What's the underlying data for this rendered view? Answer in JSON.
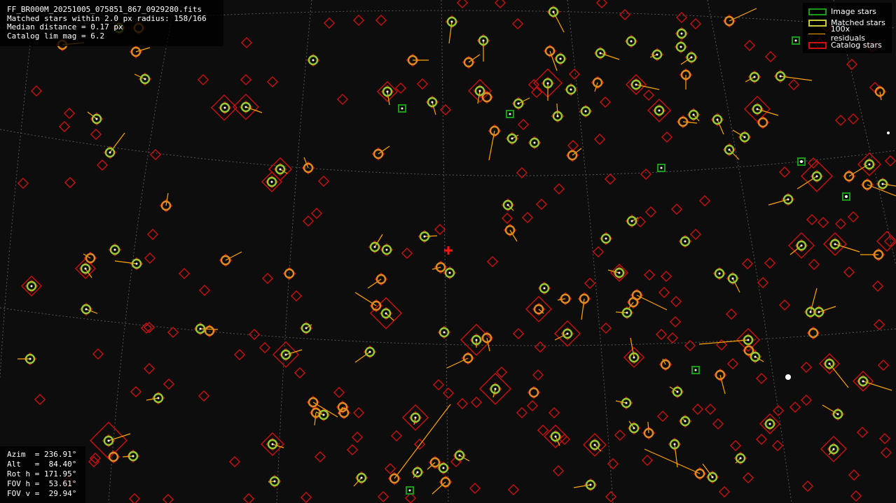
{
  "info": {
    "filename": "FF_BR000M_20251005_075851_867_0929280.fits",
    "matched_line": "Matched stars within 2.0 px radius: 158/166",
    "median_line": "Median distance = 0.17 px",
    "catalog_line": "Catalog lim mag = 6.2"
  },
  "legend": {
    "items": [
      {
        "label": "Image stars",
        "icon": "green-square-icon"
      },
      {
        "label": "Matched stars",
        "icon": "yellow-square-icon"
      },
      {
        "label": "100x residuals",
        "icon": "orange-line-icon"
      },
      {
        "label": "Catalog stars",
        "icon": "red-square-icon"
      }
    ]
  },
  "pointing": {
    "azim": "Azim  = 236.91°",
    "alt": "Alt   =  84.40°",
    "rot": "Rot h = 171.95°",
    "fovh": "FOV h =  53.61°",
    "fovv": "FOV v =  29.94°"
  },
  "colors": {
    "image_star": "#1a9a1a",
    "matched_star": "#c8c832",
    "residual": "#ffa500",
    "catalog_star": "#cc1111",
    "center_marker": "#ff1111",
    "grid": "#777777"
  },
  "icons": [
    "center-cross-icon"
  ]
}
